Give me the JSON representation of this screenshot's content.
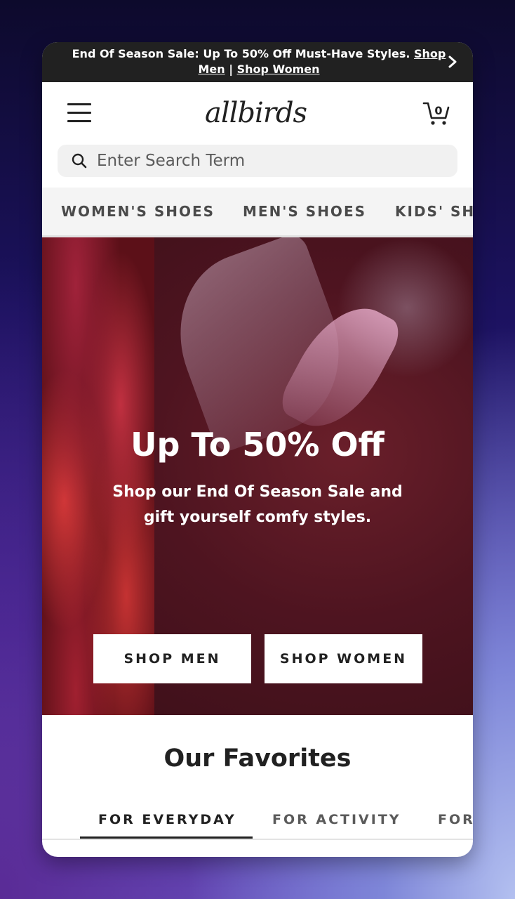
{
  "promo": {
    "text": "End Of Season Sale: Up To 50% Off Must-Have Styles. ",
    "link_shop_men": "Shop Men",
    "separator": " | ",
    "link_shop_women": "Shop Women"
  },
  "header": {
    "logo": "allbirds",
    "cart_count": "0",
    "search_placeholder": "Enter Search Term"
  },
  "categories": [
    "WOMEN'S SHOES",
    "MEN'S SHOES",
    "KIDS' SHOES"
  ],
  "hero": {
    "title": "Up To 50% Off",
    "subtitle": "Shop our End Of Season Sale and gift yourself comfy styles.",
    "btn_men": "SHOP MEN",
    "btn_women": "SHOP WOMEN"
  },
  "favorites": {
    "title": "Our Favorites",
    "tabs": [
      "FOR EVERYDAY",
      "FOR ACTIVITY",
      "FOR"
    ]
  },
  "colors": {
    "promo_bg": "#212121",
    "text_primary": "#212121",
    "search_bg": "#f1f1f1"
  },
  "icons": [
    "chevron-right-icon",
    "menu-icon",
    "cart-icon",
    "search-icon"
  ]
}
